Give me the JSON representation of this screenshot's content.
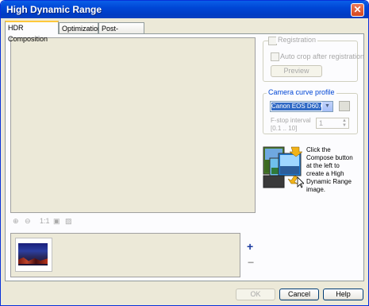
{
  "window": {
    "title": "High Dynamic Range"
  },
  "tabs": [
    {
      "label": "HDR Composition",
      "active": true
    },
    {
      "label": "Optimization",
      "active": false
    },
    {
      "label": "Post-processing",
      "active": false
    }
  ],
  "zoom_toolbar": {
    "icons": [
      "zoom-in-icon",
      "zoom-out-icon",
      "actual-size-icon",
      "fit-window-icon",
      "fit-image-icon"
    ],
    "actual_size_label": "1:1"
  },
  "registration": {
    "label": "Registration",
    "checked": false,
    "enabled": false,
    "auto_crop_label": "Auto crop after registration",
    "preview_label": "Preview"
  },
  "camera_curve": {
    "legend": "Camera curve profile",
    "selected": "Canon EOS D60.C",
    "fstop_label_line1": "F-stop interval",
    "fstop_label_line2": "[0.1 .. 10]",
    "fstop_value": "1"
  },
  "compose_help": "Click the Compose button at the left to create a High Dynamic Range image.",
  "thumbnails": {
    "add_symbol": "+",
    "remove_symbol": "−"
  },
  "buttons": {
    "ok": "OK",
    "cancel": "Cancel",
    "help": "Help"
  },
  "colors": {
    "title_bar": "#0046d5",
    "tab_highlight": "#ffc83c",
    "selection": "#316ac5"
  }
}
